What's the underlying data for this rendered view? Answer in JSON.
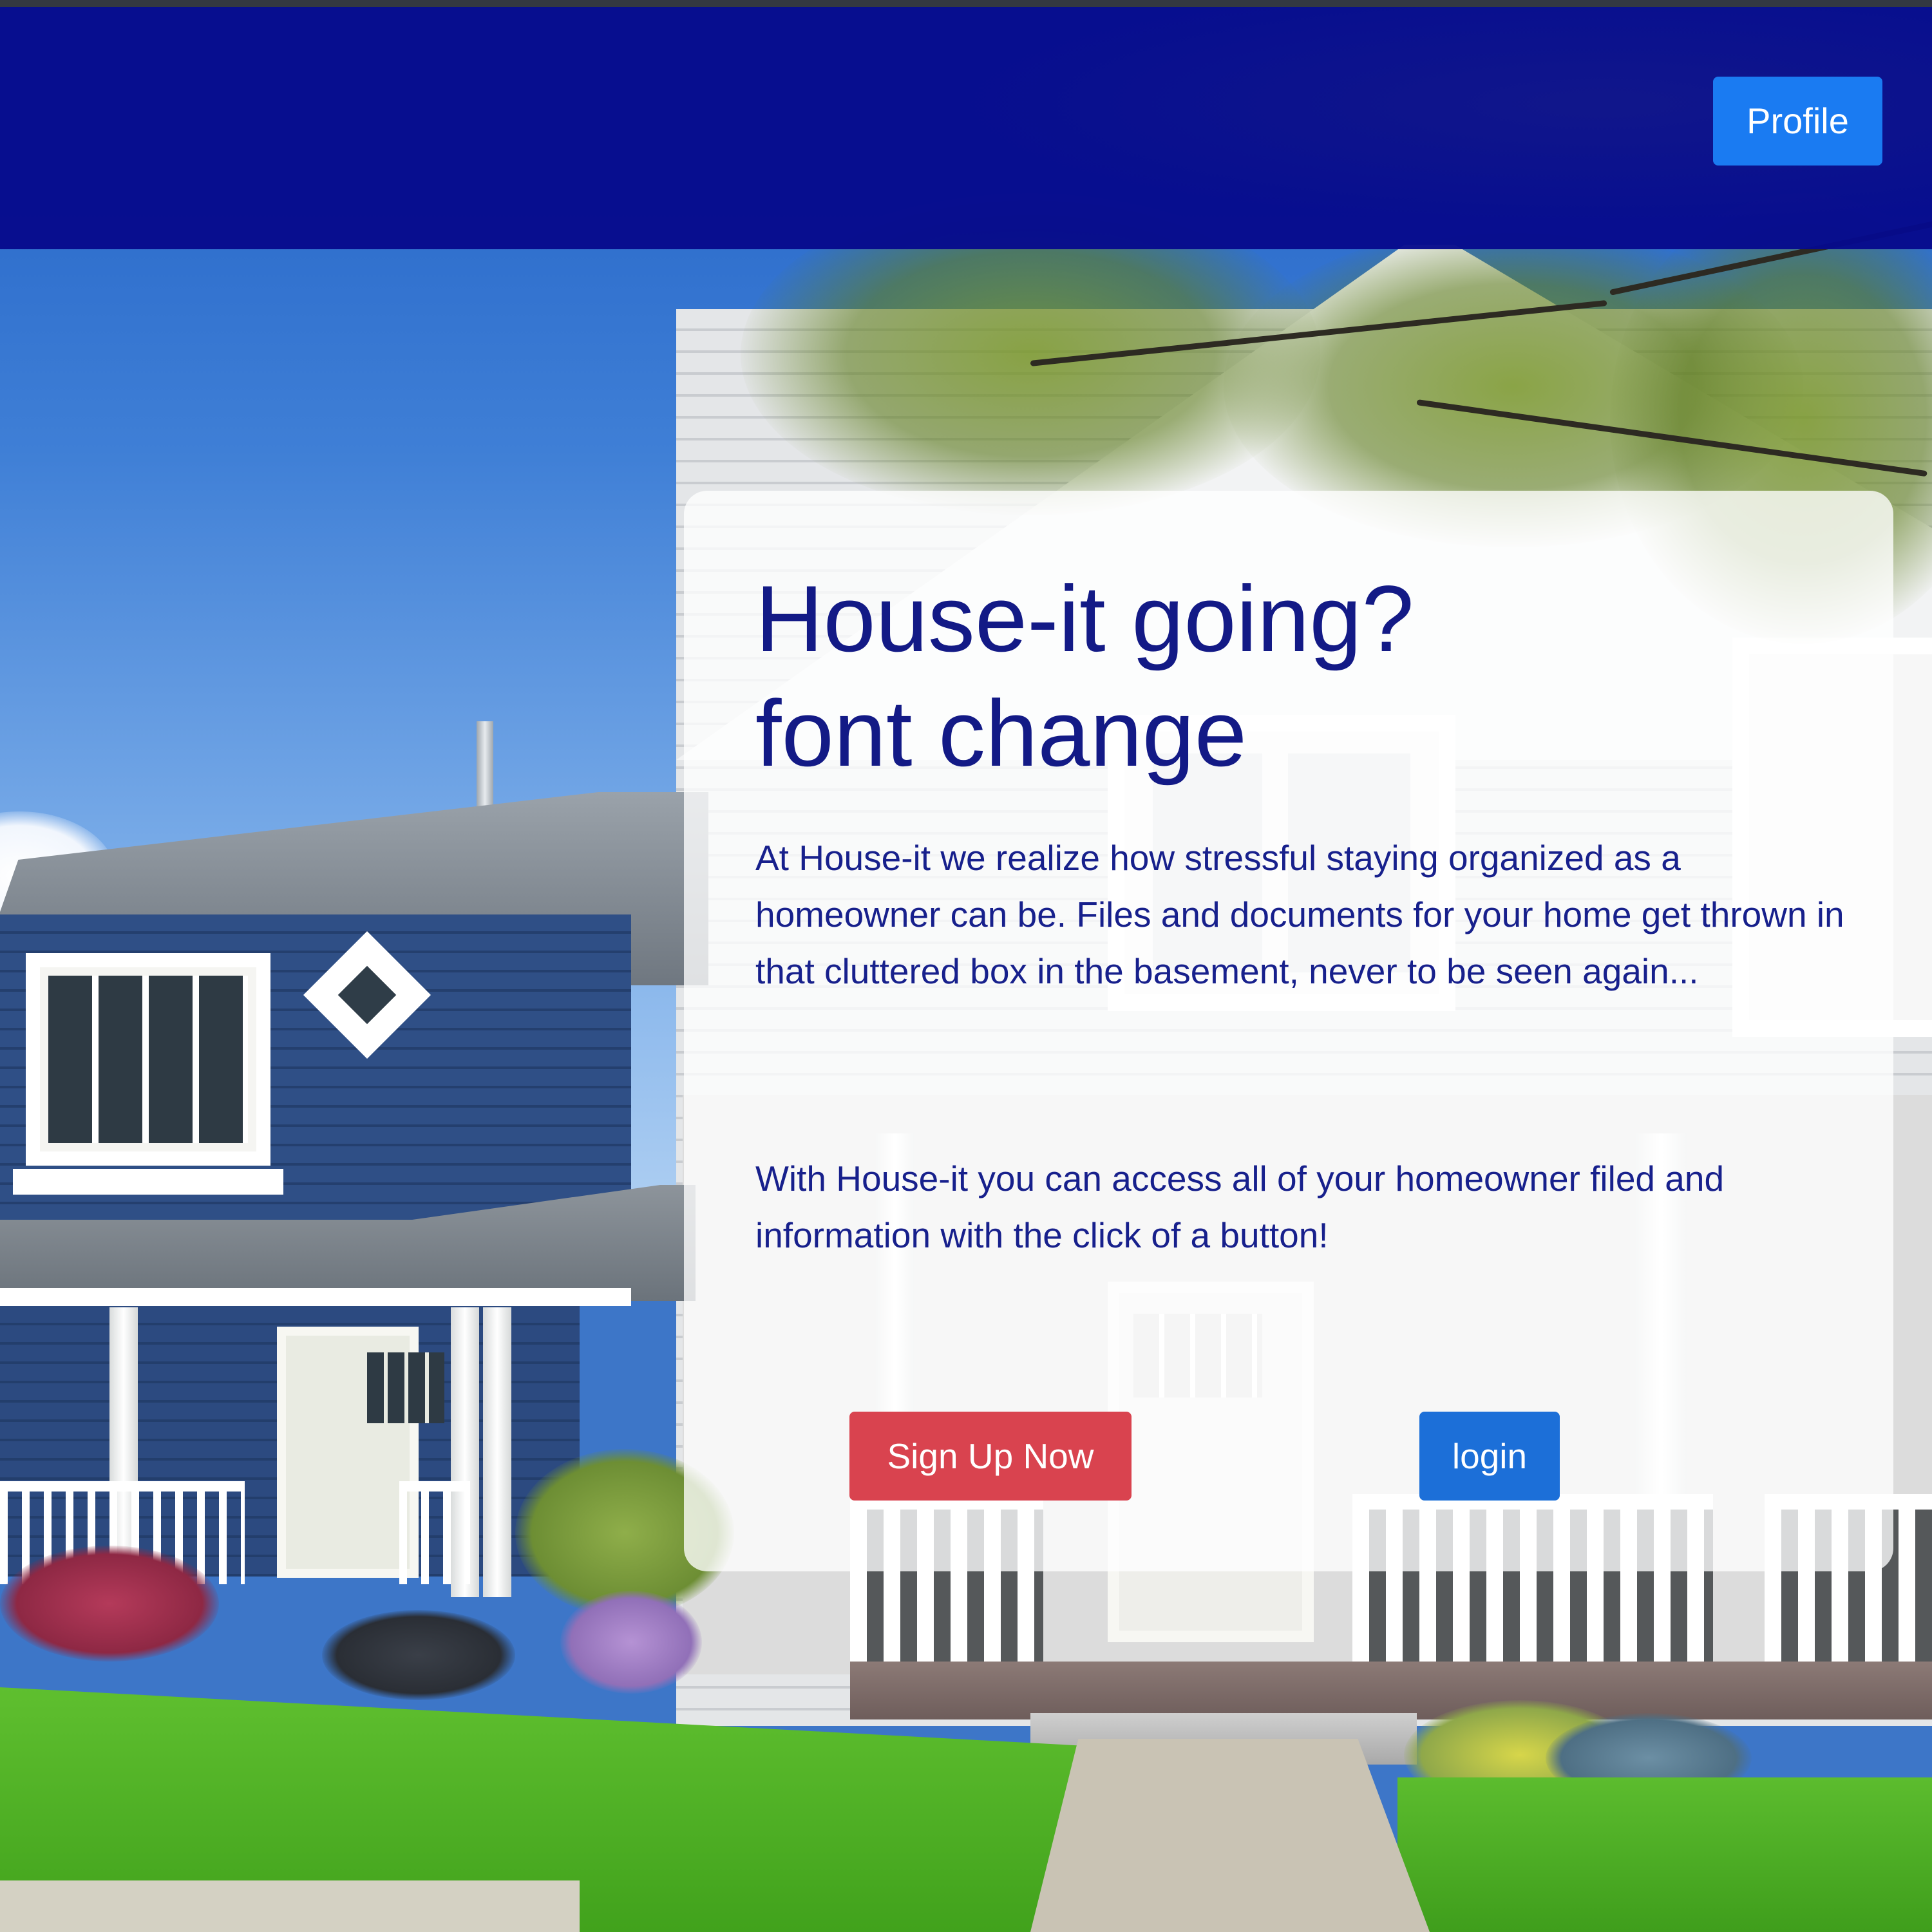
{
  "header": {
    "profile_label": "Profile",
    "background_color": "#060a8c",
    "accent_color": "#1a7bf2"
  },
  "hero": {
    "image": "house-photo",
    "card": {
      "title_line_1": "House-it going?",
      "title_line_2": "font change",
      "paragraph_1": "At House-it we realize how stressful staying organized as a homeowner can be. Files and documents for your home get thrown in that cluttered box in the basement, never to be seen again...",
      "paragraph_2": "With House-it you can access all of your homeowner filed and information with the click of a button!",
      "signup_label": "Sign Up Now",
      "login_label": "login",
      "text_color": "#131a86",
      "signup_color": "#d9434f",
      "login_color": "#1c6fd8"
    }
  }
}
